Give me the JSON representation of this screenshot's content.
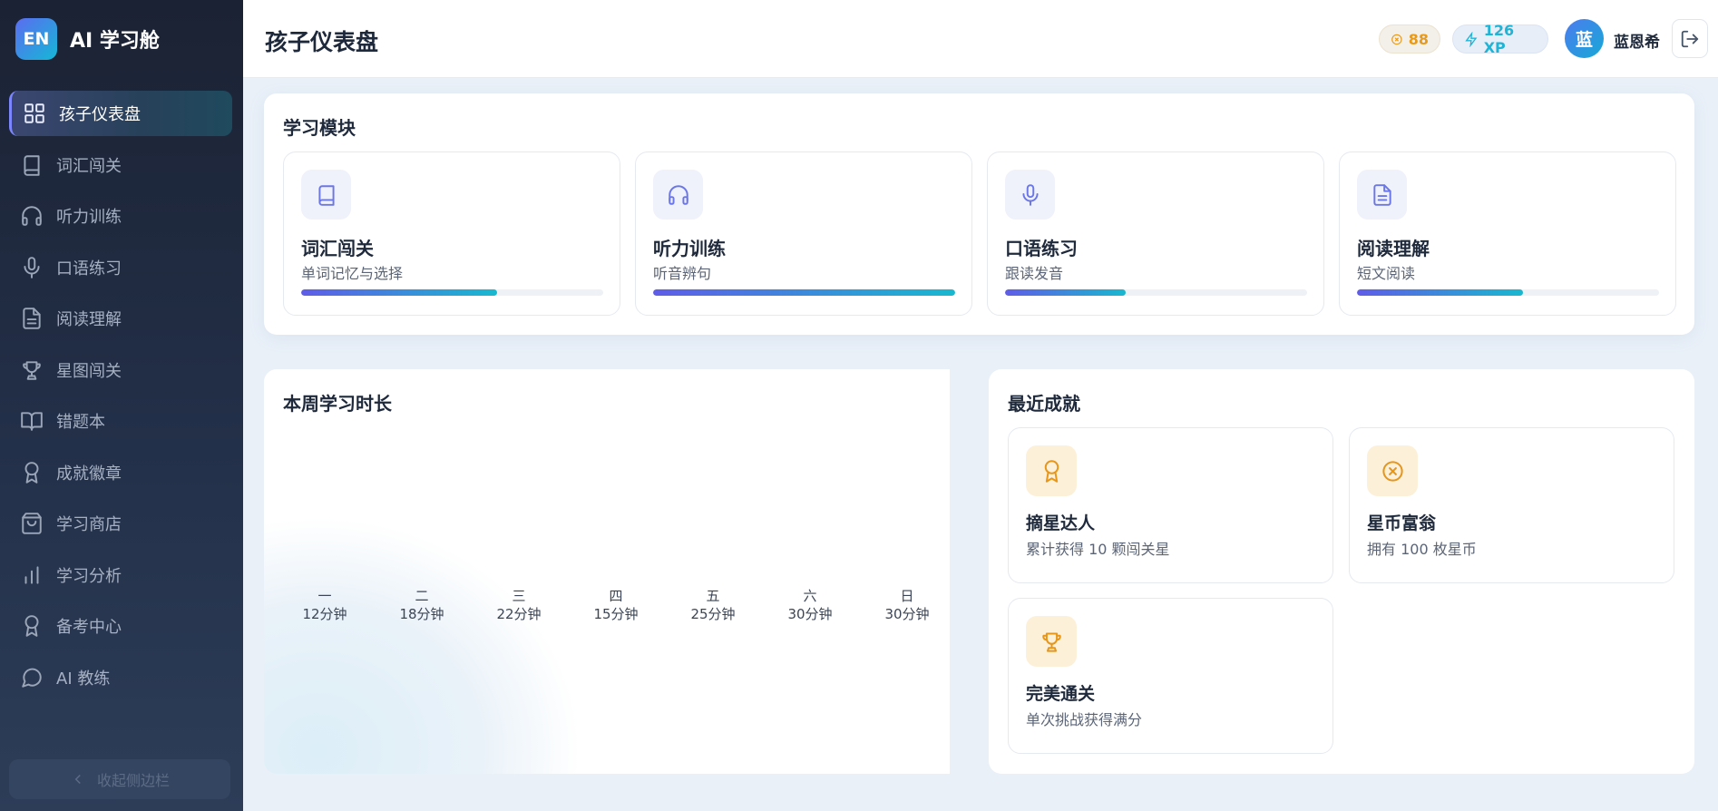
{
  "brand": {
    "logo": "EN",
    "name": "AI 学习舱"
  },
  "sidebar": {
    "items": [
      {
        "label": "孩子仪表盘",
        "icon": "dashboard-grid-icon",
        "active": true
      },
      {
        "label": "词汇闯关",
        "icon": "book-icon"
      },
      {
        "label": "听力训练",
        "icon": "headphones-icon"
      },
      {
        "label": "口语练习",
        "icon": "microphone-icon"
      },
      {
        "label": "阅读理解",
        "icon": "document-icon"
      },
      {
        "label": "星图闯关",
        "icon": "trophy-icon"
      },
      {
        "label": "错题本",
        "icon": "open-book-icon"
      },
      {
        "label": "成就徽章",
        "icon": "award-icon"
      },
      {
        "label": "学习商店",
        "icon": "shopping-bag-icon"
      },
      {
        "label": "学习分析",
        "icon": "bar-chart-icon"
      },
      {
        "label": "备考中心",
        "icon": "award-icon"
      },
      {
        "label": "AI 教练",
        "icon": "chat-bubble-icon"
      }
    ],
    "collapse_label": "收起侧边栏"
  },
  "header": {
    "title": "孩子仪表盘",
    "coins": "88",
    "xp": "126 XP",
    "avatar_initial": "蓝",
    "user_name": "蓝恩希"
  },
  "modules": {
    "title": "学习模块",
    "items": [
      {
        "title": "词汇闯关",
        "subtitle": "单词记忆与选择",
        "progress": 0.65,
        "icon": "book-icon"
      },
      {
        "title": "听力训练",
        "subtitle": "听音辨句",
        "progress": 1.0,
        "icon": "headphones-icon"
      },
      {
        "title": "口语练习",
        "subtitle": "跟读发音",
        "progress": 0.4,
        "icon": "microphone-icon"
      },
      {
        "title": "阅读理解",
        "subtitle": "短文阅读",
        "progress": 0.55,
        "icon": "document-icon"
      }
    ]
  },
  "weekly": {
    "title": "本周学习时长",
    "days": [
      {
        "day": "一",
        "minutes": "12分钟"
      },
      {
        "day": "二",
        "minutes": "18分钟"
      },
      {
        "day": "三",
        "minutes": "22分钟"
      },
      {
        "day": "四",
        "minutes": "15分钟"
      },
      {
        "day": "五",
        "minutes": "25分钟"
      },
      {
        "day": "六",
        "minutes": "30分钟"
      },
      {
        "day": "日",
        "minutes": "30分钟"
      }
    ]
  },
  "achievements": {
    "title": "最近成就",
    "items": [
      {
        "title": "摘星达人",
        "subtitle": "累计获得 10 颗闯关星",
        "icon": "award-icon"
      },
      {
        "title": "星币富翁",
        "subtitle": "拥有 100 枚星币",
        "icon": "coin-icon"
      },
      {
        "title": "完美通关",
        "subtitle": "单次挑战获得满分",
        "icon": "trophy-icon"
      }
    ]
  }
}
